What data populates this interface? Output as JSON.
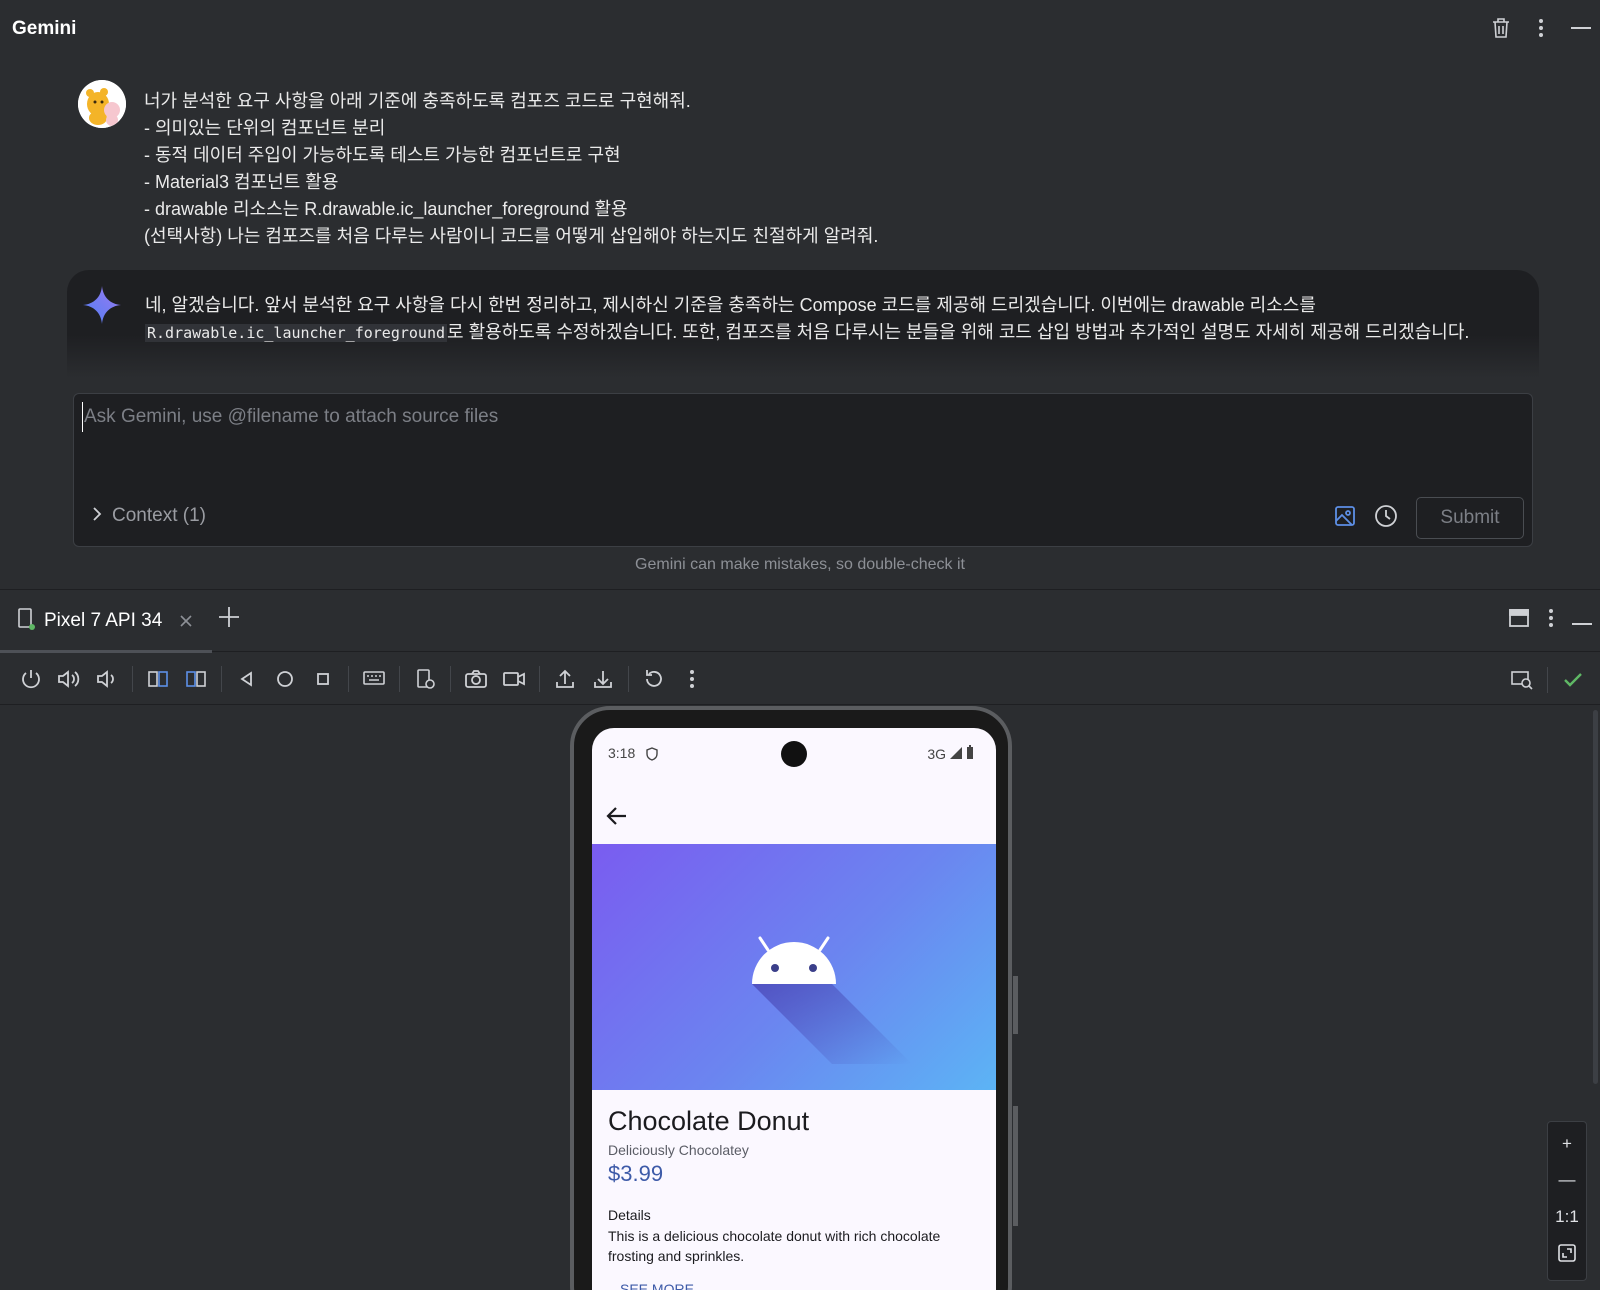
{
  "gemini": {
    "title": "Gemini",
    "user_message": {
      "lines": [
        "너가 분석한 요구 사항을 아래 기준에 충족하도록 컴포즈 코드로 구현해줘.",
        "- 의미있는 단위의 컴포넌트 분리",
        "- 동적 데이터 주입이 가능하도록 테스트 가능한 컴포넌트로 구현",
        "- Material3 컴포넌트 활용",
        "- drawable 리소스는 R.drawable.ic_launcher_foreground 활용",
        "(선택사항) 나는 컴포즈를 처음 다루는 사람이니 코드를 어떻게 삽입해야 하는지도 친절하게 알려줘."
      ]
    },
    "reply": {
      "part1": "네, 알겠습니다. 앞서 분석한 요구 사항을 다시 한번 정리하고, 제시하신 기준을 충족하는 Compose 코드를 제공해 드리겠습니다. 이번에는 drawable 리소스를",
      "code": "R.drawable.ic_launcher_foreground",
      "part2": "로 활용하도록 수정하겠습니다. 또한, 컴포즈를 처음 다루시는 분들을 위해 코드 삽입 방법과 추가적인 설명도 자세히 제공해 드리겠습니다."
    },
    "input": {
      "placeholder": "Ask Gemini, use @filename to attach source files",
      "value": ""
    },
    "context_label": "Context (1)",
    "submit_label": "Submit",
    "disclaimer": "Gemini can make mistakes, so double-check it"
  },
  "devices": {
    "tab_label": "Pixel 7 API 34",
    "toolbar_icons": [
      "power-icon",
      "volume-up-icon",
      "volume-down-icon",
      "rotate-left-icon",
      "rotate-right-icon",
      "back-icon",
      "home-icon",
      "overview-icon",
      "keyboard-icon",
      "device-settings-icon",
      "screenshot-icon",
      "screen-record-icon",
      "upload-icon",
      "download-icon",
      "reset-icon",
      "more-icon"
    ],
    "zoom": {
      "zoom_in": "+",
      "zoom_out": "—",
      "actual_size": "1:1"
    }
  },
  "phone": {
    "status_time": "3:18",
    "network": "3G",
    "product": {
      "title": "Chocolate Donut",
      "subtitle": "Deliciously Chocolatey",
      "price": "$3.99",
      "details_heading": "Details",
      "details_text": "This is a delicious chocolate donut with rich chocolate frosting and sprinkles.",
      "see_more": "SEE MORE"
    }
  },
  "colors": {
    "panel_bg": "#2b2d30",
    "input_bg": "#1e1f22",
    "accent_link": "#3d5aa8",
    "hero_gradient_start": "#7a5cf0",
    "hero_gradient_end": "#5cb4f5",
    "check_green": "#5fb865"
  }
}
